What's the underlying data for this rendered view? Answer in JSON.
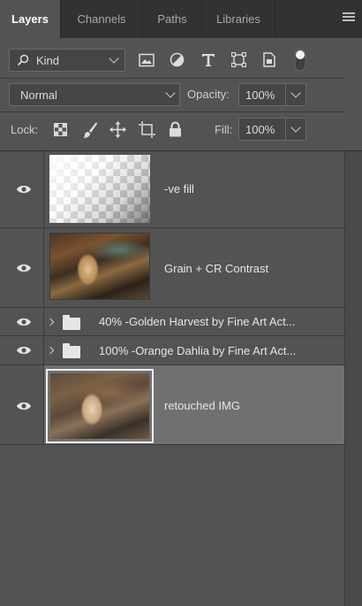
{
  "tabs": [
    {
      "label": "Layers",
      "active": true
    },
    {
      "label": "Channels",
      "active": false
    },
    {
      "label": "Paths",
      "active": false
    },
    {
      "label": "Libraries",
      "active": false
    }
  ],
  "filter": {
    "kind_label": "Kind",
    "icons": [
      "image-filter-icon",
      "adjustment-filter-icon",
      "type-filter-icon",
      "shape-filter-icon",
      "smart-object-filter-icon",
      "filter-toggle-icon"
    ]
  },
  "blend": {
    "mode": "Normal",
    "opacity_label": "Opacity:",
    "opacity_value": "100%"
  },
  "lock": {
    "label": "Lock:",
    "icons": [
      "lock-transparent-pixels-icon",
      "lock-image-pixels-icon",
      "lock-position-icon",
      "lock-artboard-icon",
      "lock-all-icon"
    ],
    "fill_label": "Fill:",
    "fill_value": "100%"
  },
  "layers": [
    {
      "name": "-ve fill",
      "type": "transparent",
      "visible": true,
      "selected": false
    },
    {
      "name": "Grain + CR Contrast",
      "type": "photo",
      "visible": true,
      "selected": false
    },
    {
      "name": "40% -Golden Harvest by Fine Art Act...",
      "type": "group",
      "visible": true,
      "selected": false
    },
    {
      "name": "100% -Orange Dahlia by Fine Art Act...",
      "type": "group",
      "visible": true,
      "selected": false
    },
    {
      "name": "retouched IMG",
      "type": "photo",
      "visible": true,
      "selected": true
    }
  ],
  "colors": {
    "panel_bg": "#535353",
    "tabbar_bg": "#323232",
    "selected_layer_bg": "#707070"
  }
}
